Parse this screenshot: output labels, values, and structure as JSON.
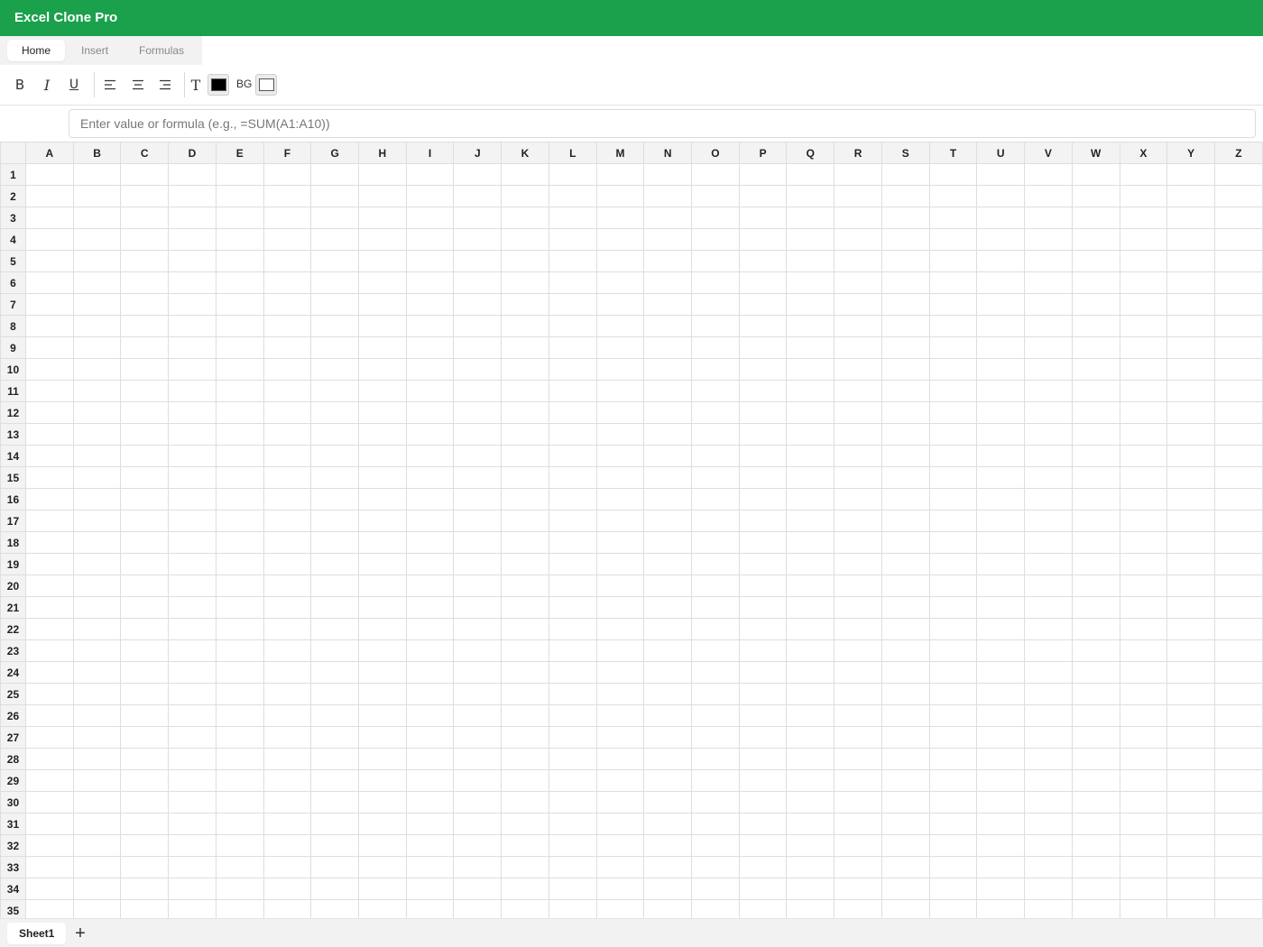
{
  "app": {
    "title": "Excel Clone Pro",
    "accent_color": "#1ba04c"
  },
  "ribbon": {
    "tabs": [
      {
        "label": "Home",
        "active": true
      },
      {
        "label": "Insert",
        "active": false
      },
      {
        "label": "Formulas",
        "active": false
      }
    ]
  },
  "toolbar": {
    "bold_glyph": "B",
    "italic_glyph": "I",
    "underline_glyph": "U",
    "align_left_icon": "align-left-icon",
    "align_center_icon": "align-center-icon",
    "align_right_icon": "align-right-icon",
    "text_color_glyph": "T",
    "text_color_value": "#000000",
    "bg_label": "BG",
    "bg_color_value": "#ffffff"
  },
  "formula_bar": {
    "value": "",
    "placeholder": "Enter value or formula (e.g., =SUM(A1:A10))"
  },
  "grid": {
    "columns": [
      "A",
      "B",
      "C",
      "D",
      "E",
      "F",
      "G",
      "H",
      "I",
      "J",
      "K",
      "L",
      "M",
      "N",
      "O",
      "P",
      "Q",
      "R",
      "S",
      "T",
      "U",
      "V",
      "W",
      "X",
      "Y",
      "Z"
    ],
    "rows": [
      "1",
      "2",
      "3",
      "4",
      "5",
      "6",
      "7",
      "8",
      "9",
      "10",
      "11",
      "12",
      "13",
      "14",
      "15",
      "16",
      "17",
      "18",
      "19",
      "20",
      "21",
      "22",
      "23",
      "24",
      "25",
      "26",
      "27",
      "28",
      "29",
      "30",
      "31",
      "32",
      "33",
      "34",
      "35"
    ]
  },
  "sheets": {
    "tabs": [
      "Sheet1"
    ],
    "add_label": "+"
  }
}
